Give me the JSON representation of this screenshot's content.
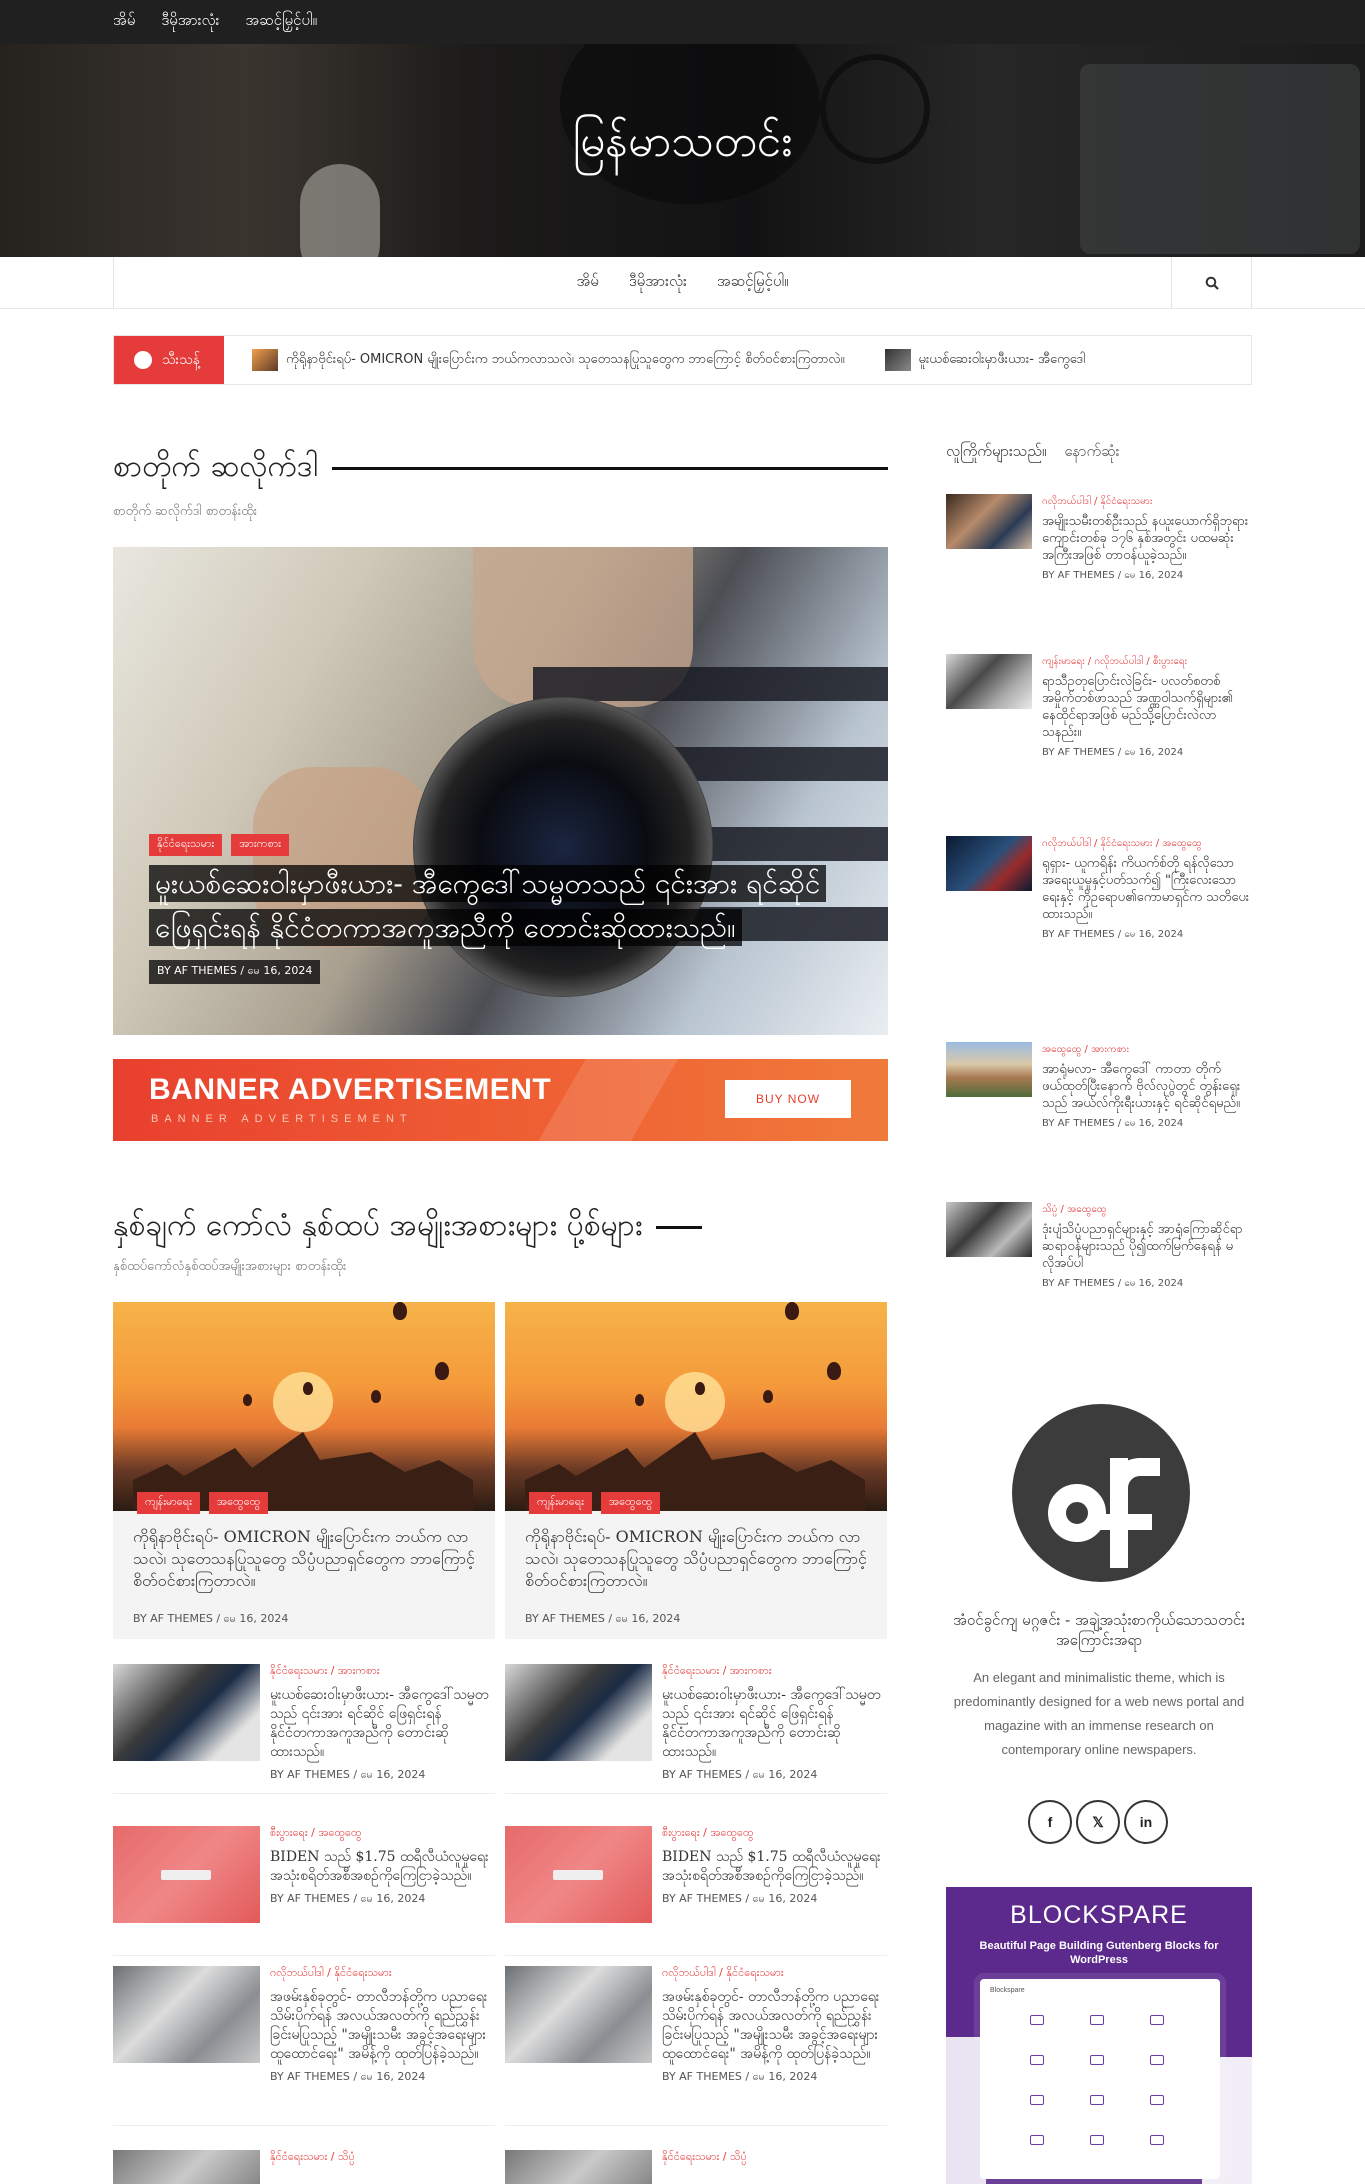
{
  "topbar": {
    "nav": [
      "အိမ်",
      "ဒီမိုအားလုံး",
      "အဆင့်မြှင့်ပါ။"
    ]
  },
  "header": {
    "site_title": "မြန်မာသတင်း"
  },
  "main_nav": {
    "items": [
      "အိမ်",
      "ဒီမိုအားလုံး",
      "အဆင့်မြှင့်ပါ။"
    ],
    "search_icon": "search-icon"
  },
  "ticker": {
    "label": "သီးသန့်",
    "items": [
      "ကိုရိုနာဗိုင်းရပ်- OMICRON မျိုးပြောင်းက ဘယ်ကလာသလဲ၊ သုတေသနပြုသူတွေက ဘာကြောင့် စိတ်ဝင်စားကြတာလဲ။",
      "မူးယစ်ဆေးဝါးမှာဖီးယား- အီကွေဒေါ"
    ]
  },
  "section1": {
    "title": "စာတိုက် ဆလိုက်ဒါ",
    "subtitle": "စာတိုက် ဆလိုက်ဒါ စာတန်းထိုး"
  },
  "featured": {
    "categories": [
      "နိုင်ငံရေးသမား",
      "အားကစား"
    ],
    "title": "မူးယစ်ဆေးဝါးမှာဖီးယား- အီကွေဒေါ်သမ္မတသည် ၎င်းအား ရင်ဆိုင်ဖြေရှင်းရန် နိုင်ငံတကာအကူအညီကို တောင်းဆိုထားသည်။",
    "author": "BY AF THEMES",
    "date": "မေ 16, 2024"
  },
  "banner": {
    "title": "BANNER ADVERTISEMENT",
    "subtitle": "BANNER ADVERTISEMENT",
    "button": "BUY NOW"
  },
  "section2": {
    "title": "နှစ်ချက် ကော်လံ နှစ်ထပ် အမျိုးအစားများ ပို့စ်များ",
    "subtitle": "နှစ်ထပ်ကော်လံနှစ်ထပ်အမျိုးအစားများ စာတန်းထိုး"
  },
  "grid_cards": [
    {
      "categories": [
        "ကျန်းမာရေး",
        "အထွေထွေ"
      ],
      "title": "ကိုရိုနာဗိုင်းရပ်- OMICRON မျိုးပြောင်းက ဘယ်က လာသလဲ၊ သုတေသနပြုသူတွေ သိပ္ပံပညာရှင်တွေက ဘာကြောင့် စိတ်ဝင်စားကြတာလဲ။",
      "author": "BY AF THEMES",
      "date": "မေ 16, 2024"
    },
    {
      "categories": [
        "ကျန်းမာရေး",
        "အထွေထွေ"
      ],
      "title": "ကိုရိုနာဗိုင်းရပ်- OMICRON မျိုးပြောင်းက ဘယ်က လာသလဲ၊ သုတေသနပြုသူတွေ သိပ္ပံပညာရှင်တွေက ဘာကြောင့် စိတ်ဝင်စားကြတာလဲ။",
      "author": "BY AF THEMES",
      "date": "မေ 16, 2024"
    }
  ],
  "list_items": [
    {
      "categories": "နိုင်ငံရေးသမား / အားကစား",
      "title": "မူးယစ်ဆေးဝါးမှာဖီးယား- အီကွေဒေါ်သမ္မတသည် ၎င်းအား ရင်ဆိုင် ဖြေရှင်းရန် နိုင်ငံတကာအကူအညီကို တောင်းဆိုထားသည်။",
      "author": "BY AF THEMES",
      "date": "မေ 16, 2024"
    },
    {
      "categories": "စီးပွားရေး / အထွေထွေ",
      "title": "BIDEN သည် $1.75 ထရီလီယံလူမှုရေး အသုံးစရိတ်အစီအစဉ်ကိုကြေငြာခဲ့သည်။",
      "author": "BY AF THEMES",
      "date": "မေ 16, 2024"
    },
    {
      "categories": "ဂလိုဘယ်ပါဒါ / နိုင်ငံရေးသမား",
      "title": "အဖမ်းနှစ်ခုတွင်- တာလီဘန်တို့က ပညာရေး သိမ်းပိုက်ရန် အလယ်အလတ်ကို ရည်ညွှန်းခြင်းမပြုသည့် \"အမျိုးသမီး အခွင့်အရေးများ ထူထောင်ရေး\" အမိန့်ကို ထုတ်ပြန်ခဲ့သည်။",
      "author": "BY AF THEMES",
      "date": "မေ 16, 2024"
    },
    {
      "categories": "နိုင်ငံရေးသမား / သိပ္ပံ",
      "title": "",
      "author": "",
      "date": ""
    }
  ],
  "sidebar": {
    "tabs": [
      "လူကြိုက်များသည်။",
      "နောက်ဆုံး"
    ],
    "items": [
      {
        "categories": "ဂလိုဘယ်ပါဒါ / နိုင်ငံရေးသမား",
        "title": "အမျိုးသမီးတစ်ဦးသည် နယူးယောက်ရှိဘုရားကျောင်းတစ်ခု ၁၇၆ နှစ်အတွင်း ပထမဆုံးအကြီးအဖြစ် တာဝန်ယူခဲ့သည်။",
        "author": "BY AF THEMES",
        "date": "မေ 16, 2024"
      },
      {
        "categories": "ကျန်းမာရေး / ဂလိုဘယ်ပါဒါ / စီးပွားရေး",
        "title": "ရာသီဥတုပြောင်းလဲခြင်း- ပလတ်စတစ်အမှိုက်တစ်ဖာသည် အဏ္ဏဝါသက်ရှိများ၏ နေထိုင်ရာအဖြစ် မည်သို့ပြောင်းလဲလာသနည်း။",
        "author": "BY AF THEMES",
        "date": "မေ 16, 2024"
      },
      {
        "categories": "ဂလိုဘယ်ပါဒါ / နိုင်ငံရေးသမား / အထွေထွေ",
        "title": "ရုရှား- ယူကရိန်း ကိယက်စ်တို ရန်လိုသော အရေးယူမှုနှင့်ပတ်သက်၍ \"ကြီးလေးသောရေးနှင့် ကိုဥရောပ၏ကောမာရှင်က သတိပေးထားသည်။",
        "author": "BY AF THEMES",
        "date": "မေ 16, 2024"
      },
      {
        "categories": "အထွေထွေ / အားကစား",
        "title": "အာရုံမလာ- အီကွေဒေါ် ကာတာ တိုက် ဖယ်ထုတ်ပြီးနောက် ဗိုလ်လုပွဲတွင် တွန်းရှေးသည် အယ်လ်ကိုးရီးယားနှင့် ရင်ဆိုင်ရမည်။",
        "author": "BY AF THEMES",
        "date": "မေ 16, 2024"
      },
      {
        "categories": "သိပ္ပံ / အထွေထွေ",
        "title": "ဒုံးပျံသိပ္ပံပညာရှင်များနှင့် အာရုံကြောဆိုင်ရာဆရာဝန်များသည် ပို၍ထက်မြက်နေရန် မလိုအပ်ပါ",
        "author": "BY AF THEMES",
        "date": "မေ 16, 2024"
      }
    ],
    "about": {
      "title": "အံဝင်ခွင်ကျ မဂ္ဂဇင်း - အချဲ့အသုံးစာကိုယ်သောသတင်းအကြောင်းအရာ",
      "description": "An elegant and minimalistic theme, which is predominantly designed for a web news portal and magazine with an immense research on contemporary online newspapers.",
      "social": [
        "f",
        "𝕏",
        "in"
      ]
    },
    "ad": {
      "title": "BLOCKSPARE",
      "subtitle": "Beautiful Page Building Gutenberg Blocks for WordPress",
      "screen_label": "Blockspare"
    }
  }
}
